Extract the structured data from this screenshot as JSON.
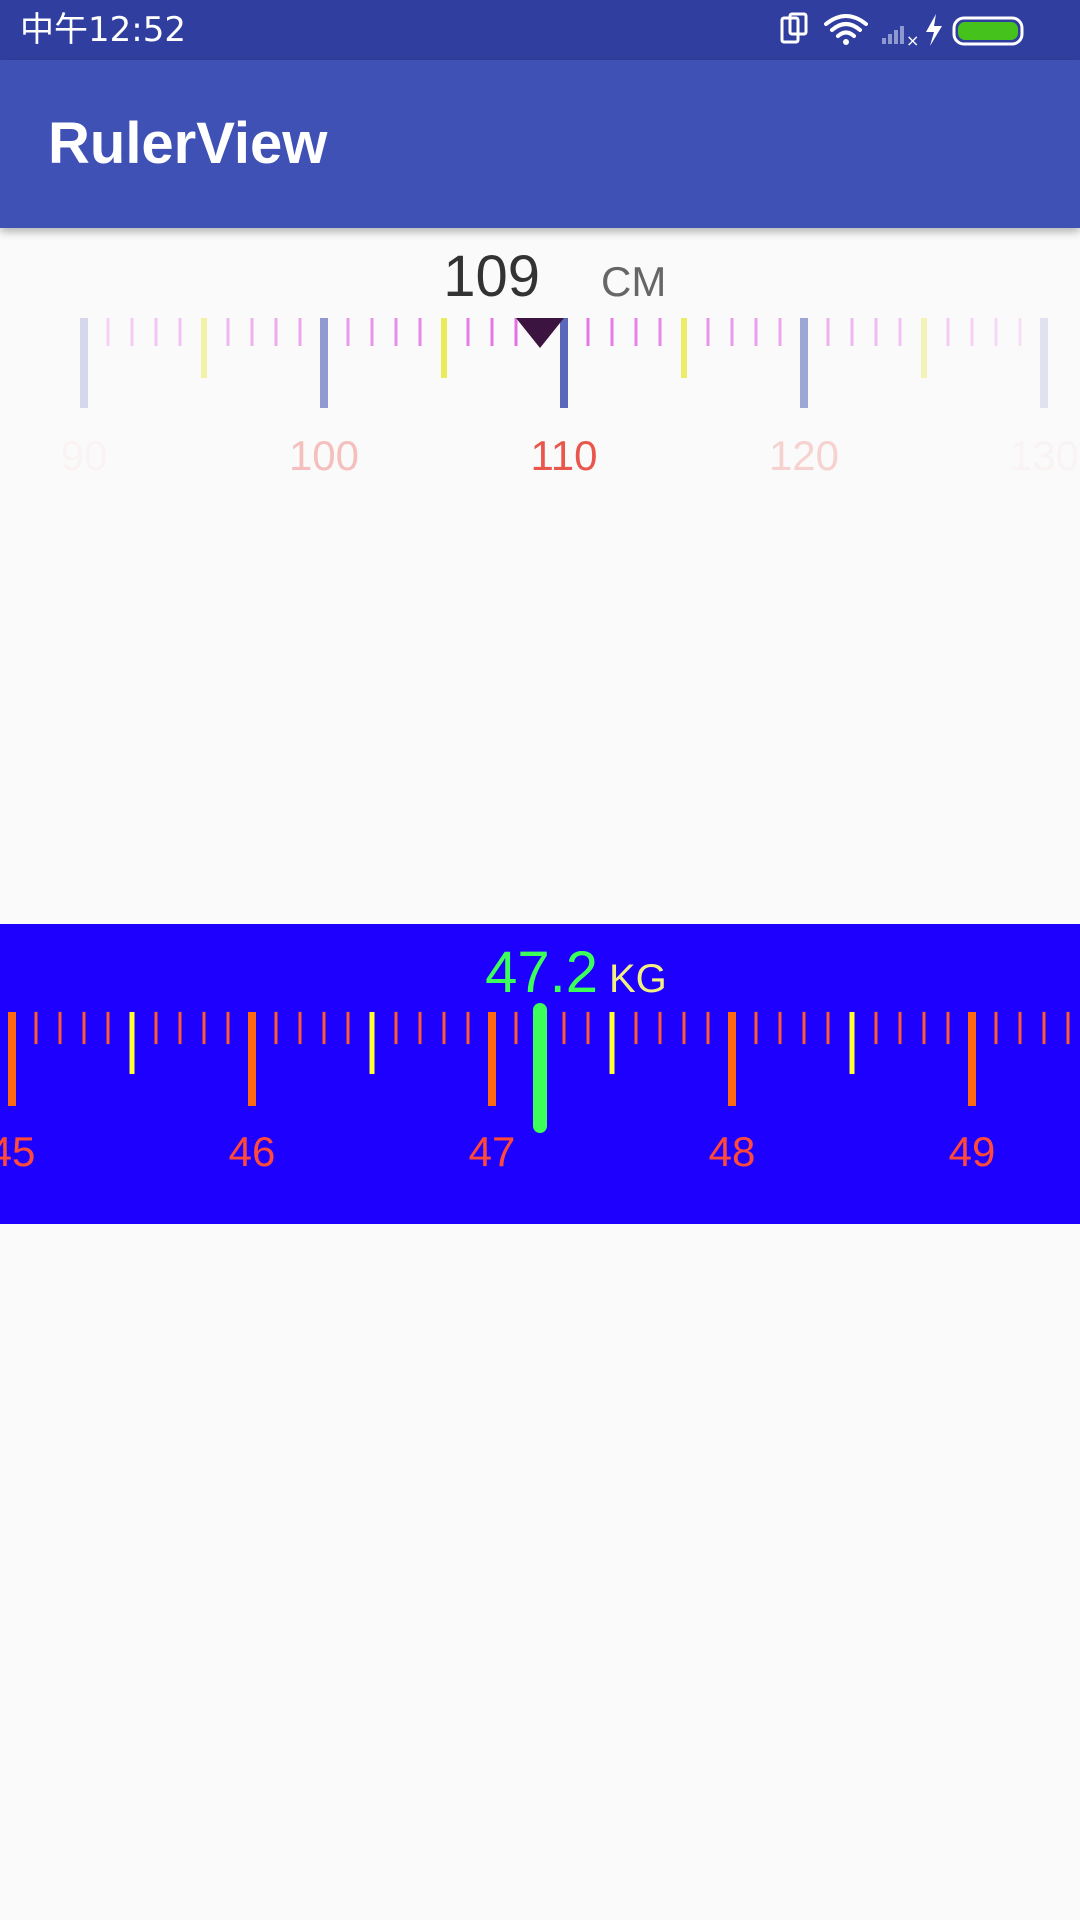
{
  "status_bar": {
    "time": "中午12:52",
    "icons": [
      "screen-rotate-icon",
      "wifi-icon",
      "signal-no-service-icon",
      "charging-bolt-icon",
      "battery-icon"
    ],
    "battery_color": "#45c21c"
  },
  "app_bar": {
    "title": "RulerView",
    "color": "#3f51b5",
    "status_color": "#303f9f"
  },
  "height_ruler": {
    "value": "109",
    "unit": "CM",
    "current": 109,
    "visible_labels": [
      "90",
      "100",
      "110",
      "120",
      "130"
    ],
    "colors": {
      "background": "#fafafa",
      "value_text": "#333333",
      "unit_text": "#666666",
      "tick_minor": "#e36be6",
      "tick_half": "#e8e83c",
      "tick_major": "#5463b9",
      "label": "#e8473b",
      "indicator": "#3b1440"
    }
  },
  "weight_ruler": {
    "value": "47.2",
    "unit": "KG",
    "current": 47.2,
    "visible_labels": [
      "45",
      "46",
      "47",
      "48",
      "49"
    ],
    "colors": {
      "background": "#1e00ff",
      "value_text": "#3dff5a",
      "unit_text": "#f2f080",
      "tick_minor": "#ff5a30",
      "tick_half": "#ffff33",
      "tick_major": "#ff6a10",
      "label": "#ff4a3a",
      "indicator": "#3dff5a"
    }
  }
}
